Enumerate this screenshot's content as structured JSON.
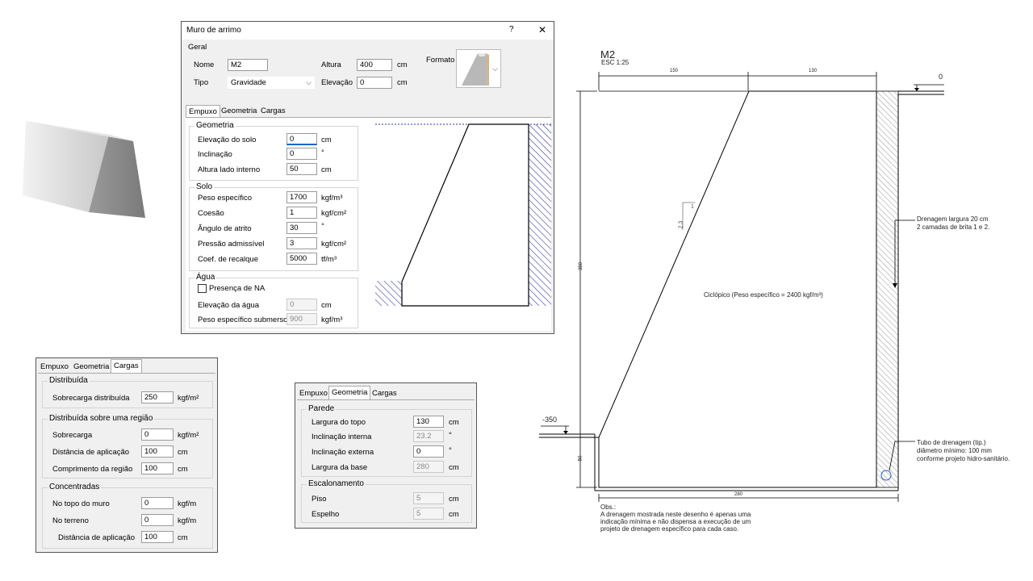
{
  "dialog": {
    "title": "Muro de arrimo",
    "help": "?",
    "close": "✕",
    "geral": {
      "title": "Geral",
      "nome_label": "Nome",
      "nome_value": "M2",
      "tipo_label": "Tipo",
      "tipo_value": "Gravidade",
      "altura_label": "Altura",
      "altura_value": "400",
      "altura_unit": "cm",
      "elevacao_label": "Elevação",
      "elevacao_value": "0",
      "elevacao_unit": "cm",
      "formato_label": "Formato"
    },
    "tabs": [
      "Empuxo",
      "Geometria",
      "Cargas"
    ],
    "geometria": {
      "title": "Geometria",
      "rows": [
        {
          "label": "Elevação do solo",
          "value": "0",
          "unit": "cm"
        },
        {
          "label": "Inclinação",
          "value": "0",
          "unit": "°"
        },
        {
          "label": "Altura lado interno",
          "value": "50",
          "unit": "cm"
        }
      ]
    },
    "solo": {
      "title": "Solo",
      "rows": [
        {
          "label": "Peso específico",
          "value": "1700",
          "unit": "kgf/m³"
        },
        {
          "label": "Coesão",
          "value": "1",
          "unit": "kgf/cm²"
        },
        {
          "label": "Ângulo de atrito",
          "value": "30",
          "unit": "°"
        },
        {
          "label": "Pressão admissível",
          "value": "3",
          "unit": "kgf/cm²"
        },
        {
          "label": "Coef. de recalque",
          "value": "5000",
          "unit": "tf/m³"
        }
      ]
    },
    "agua": {
      "title": "Água",
      "checkbox": "Presença de NA",
      "rows": [
        {
          "label": "Elevação da água",
          "value": "0",
          "unit": "cm"
        },
        {
          "label": "Peso específico submerso",
          "value": "900",
          "unit": "kgf/m³"
        }
      ]
    }
  },
  "cargas_panel": {
    "tabs": [
      "Empuxo",
      "Geometria",
      "Cargas"
    ],
    "distribuida": {
      "title": "Distribuída",
      "rows": [
        {
          "label": "Sobrecarga distribuída",
          "value": "250",
          "unit": "kgf/m²"
        }
      ]
    },
    "regiao": {
      "title": "Distribuída sobre uma região",
      "rows": [
        {
          "label": "Sobrecarga",
          "value": "0",
          "unit": "kgf/m²"
        },
        {
          "label": "Distância de aplicação",
          "value": "100",
          "unit": "cm"
        },
        {
          "label": "Comprimento da região",
          "value": "100",
          "unit": "cm"
        }
      ]
    },
    "concentradas": {
      "title": "Concentradas",
      "rows": [
        {
          "label": "No topo do muro",
          "value": "0",
          "unit": "kgf/m"
        },
        {
          "label": "No terreno",
          "value": "0",
          "unit": "kgf/m"
        },
        {
          "label": "Distância de aplicação",
          "value": "100",
          "unit": "cm"
        }
      ]
    }
  },
  "geometria_panel": {
    "tabs": [
      "Empuxo",
      "Geometria",
      "Cargas"
    ],
    "parede": {
      "title": "Parede",
      "rows": [
        {
          "label": "Largura do topo",
          "value": "130",
          "unit": "cm"
        },
        {
          "label": "Inclinação interna",
          "value": "23.2",
          "unit": "°"
        },
        {
          "label": "Inclinação externa",
          "value": "0",
          "unit": "°"
        },
        {
          "label": "Largura da base",
          "value": "280",
          "unit": "cm"
        }
      ]
    },
    "escalonamento": {
      "title": "Escalonamento",
      "rows": [
        {
          "label": "Piso",
          "value": "5",
          "unit": "cm"
        },
        {
          "label": "Espelho",
          "value": "5",
          "unit": "cm"
        }
      ]
    }
  },
  "drawing": {
    "title": "M2",
    "scale": "ESC 1:25",
    "dim_top_left": "150",
    "dim_top_right": "130",
    "dim_height": "350",
    "dim_base": "280",
    "dim_base_left": "50",
    "level_top": "0",
    "level_left": "-350",
    "slope_1": "1",
    "slope_2": "2.3",
    "material": "Ciclópico (Peso específico = 2400 kgf/m³)",
    "drain_note_1": "Drenagem largura 20 cm",
    "drain_note_2": "2 camadas de brita 1 e 2.",
    "tube_note_1": "Tubo de drenagem (tip.)",
    "tube_note_2": "diâmetro mínimo: 100 mm",
    "tube_note_3": "conforme projeto hidro-sanitário.",
    "obs_1": "Obs.:",
    "obs_2": "A drenagem mostrada neste desenho é apenas uma",
    "obs_3": "indicação mínima e não dispensa a execução de um",
    "obs_4": "projeto de drenagem específico para cada caso."
  }
}
